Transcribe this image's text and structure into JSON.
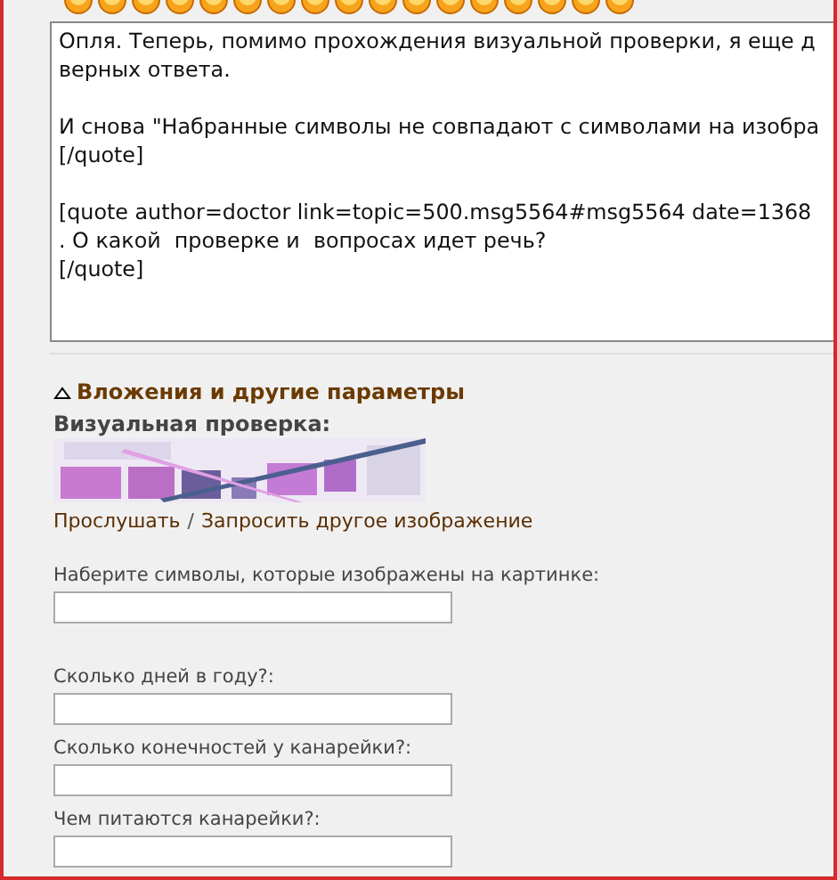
{
  "message": {
    "paragraphs": [
      [
        "Опля. Теперь, помимо прохождения визуальной проверки, я еще д",
        "верных ответа."
      ],
      [
        "И снова \"Набранные символы не совпадают с символами на изобра",
        "[/quote]"
      ],
      [
        "[quote author=doctor link=topic=500.msg5564#msg5564 date=1368",
        ". О какой  проверке и  вопросах идет речь?",
        "[/quote]"
      ]
    ]
  },
  "attachments": {
    "title": "Вложения и другие параметры",
    "expanded": true
  },
  "verification": {
    "title": "Визуальная проверка:",
    "listen_link": "Прослушать",
    "separator": "/",
    "refresh_link": "Запросить другое изображение"
  },
  "fields": [
    {
      "label": "Наберите символы, которые изображены на картинке:"
    },
    {
      "label": "Сколько дней в году?:"
    },
    {
      "label": "Сколько конечностей у канарейки?:"
    },
    {
      "label": "Чем питаются канарейки?:"
    }
  ]
}
